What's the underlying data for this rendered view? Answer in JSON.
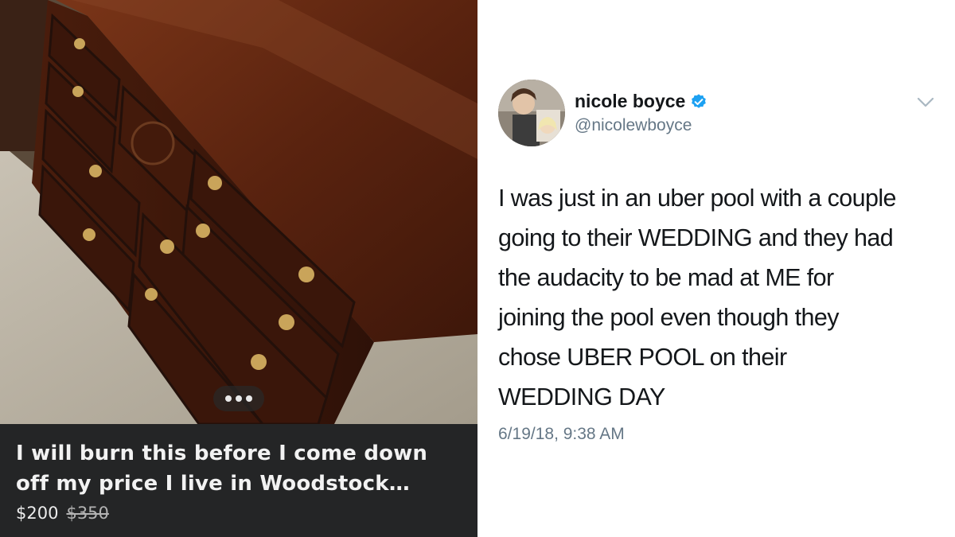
{
  "listing": {
    "title": "I will burn this before I come down off my price I live in Woodstock Georgi...",
    "price": "$200",
    "original_price": "$350",
    "photo_description_icon": "dresser-photo",
    "more_icon": "more-dots-icon"
  },
  "tweet": {
    "display_name": "nicole boyce",
    "handle": "@nicolewboyce",
    "verified": true,
    "text_lines": [
      "I was just in an uber pool with a couple",
      "going to their WEDDING and they had",
      "the audacity to be mad at ME for",
      "joining the pool even though they",
      "chose UBER POOL on their",
      "WEDDING DAY"
    ],
    "timestamp": "6/19/18, 9:38 AM",
    "colors": {
      "verified": "#1da1f2",
      "secondary_text": "#657786",
      "primary_text": "#14171a"
    }
  }
}
